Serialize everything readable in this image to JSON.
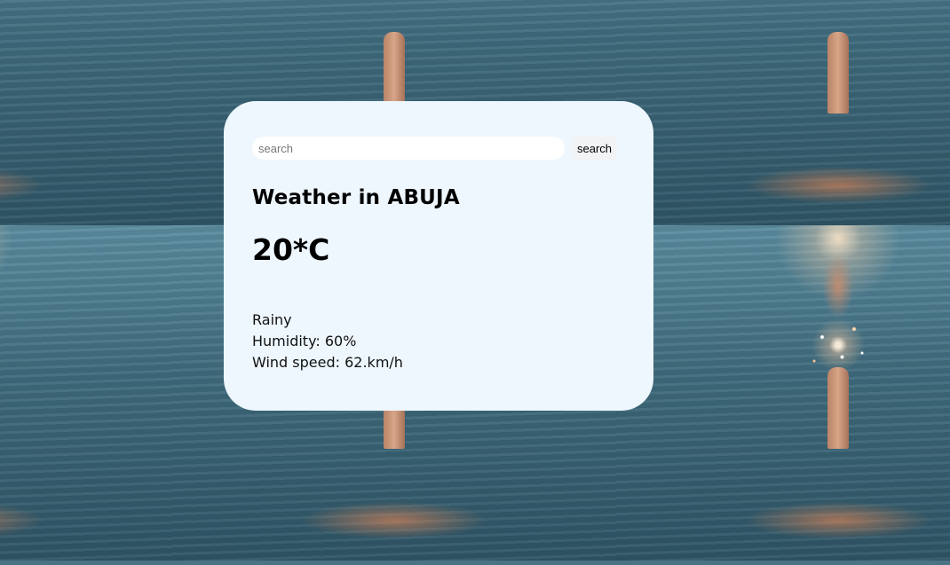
{
  "search": {
    "placeholder": "search",
    "button_label": "search"
  },
  "weather": {
    "title": "Weather in ABUJA",
    "temperature": "20*C",
    "description": "Rainy",
    "humidity": "Humidity: 60%",
    "wind": "Wind speed: 62.km/h"
  },
  "colors": {
    "card_background": "#eef7fe",
    "text": "#000000"
  }
}
